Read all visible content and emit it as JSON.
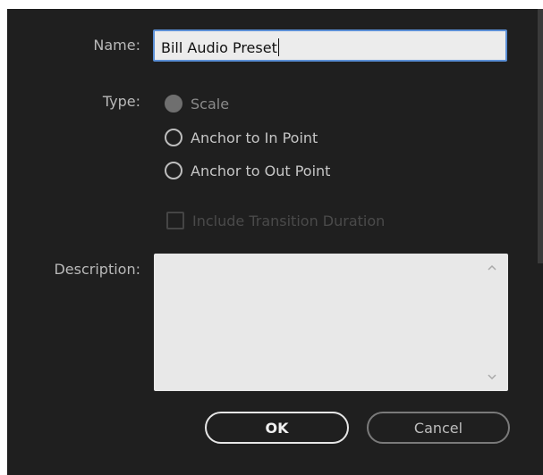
{
  "form": {
    "name_label": "Name:",
    "name_value": "Bill Audio Preset",
    "type_label": "Type:",
    "type_options": [
      {
        "label": "Scale",
        "state": "disabled-selected"
      },
      {
        "label": "Anchor to In Point",
        "state": "unselected"
      },
      {
        "label": "Anchor to Out Point",
        "state": "unselected"
      }
    ],
    "include_transition_label": "Include Transition Duration",
    "description_label": "Description:",
    "description_value": ""
  },
  "buttons": {
    "ok_label": "OK",
    "cancel_label": "Cancel"
  },
  "colors": {
    "background": "#1f1f1f",
    "input_bg": "#ececec",
    "focus_border": "#5b8fd6",
    "text": "#c6c6c6",
    "disabled_text": "#4a4a4a"
  },
  "icons": {
    "scroll_up": "chevron-up-icon",
    "scroll_down": "chevron-down-icon"
  }
}
